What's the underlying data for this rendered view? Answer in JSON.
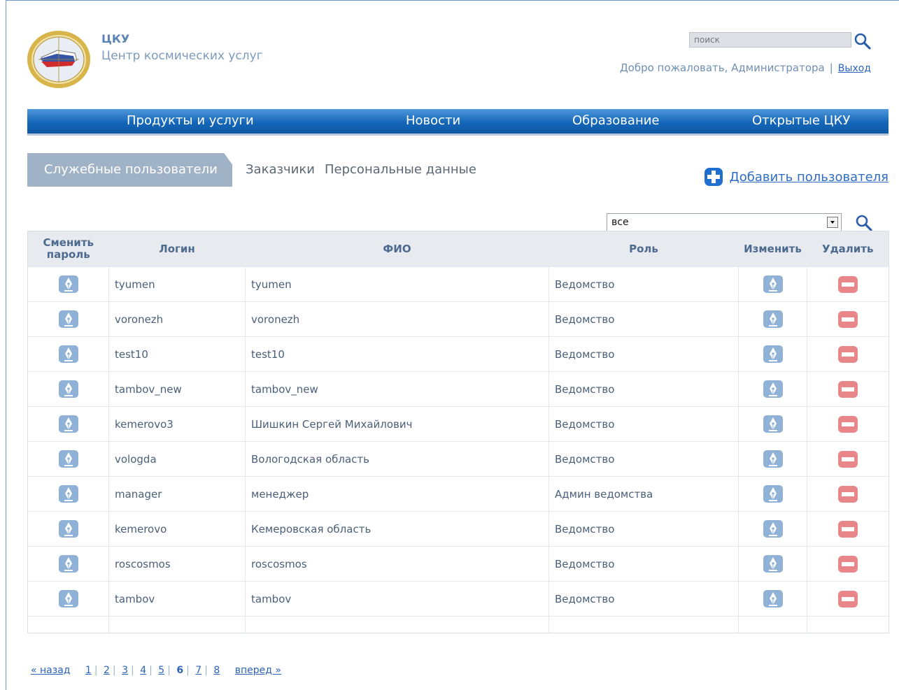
{
  "header": {
    "brand_short": "ЦКУ",
    "brand_full": "Центр космических услуг",
    "search_placeholder": "поиск",
    "welcome_text": "Добро пожаловать, Администратора",
    "separator": "|",
    "logout_label": "Выход"
  },
  "nav": {
    "items": [
      {
        "label": "Продукты и услуги"
      },
      {
        "label": "Новости"
      },
      {
        "label": "Образование"
      },
      {
        "label": "Открытые ЦКУ"
      }
    ]
  },
  "tabs": {
    "active_label": "Служебные пользователи",
    "items": [
      {
        "label": "Заказчики"
      },
      {
        "label": "Персональные данные"
      }
    ]
  },
  "add_user_label": "Добавить пользователя",
  "filter": {
    "selected": "все"
  },
  "table": {
    "headers": {
      "change_password": "Сменить пароль",
      "login": "Логин",
      "fio": "ФИО",
      "role": "Роль",
      "edit": "Изменить",
      "delete": "Удалить"
    },
    "rows": [
      {
        "login": "tyumen",
        "fio": "tyumen",
        "role": "Ведомство"
      },
      {
        "login": "voronezh",
        "fio": "voronezh",
        "role": "Ведомство"
      },
      {
        "login": "test10",
        "fio": "test10",
        "role": "Ведомство"
      },
      {
        "login": "tambov_new",
        "fio": "tambov_new",
        "role": "Ведомство"
      },
      {
        "login": "kemerovo3",
        "fio": "Шишкин Сергей Михайлович",
        "role": "Ведомство"
      },
      {
        "login": "vologda",
        "fio": "Вологодская область",
        "role": "Ведомство"
      },
      {
        "login": "manager",
        "fio": "менеджер",
        "role": "Админ ведомства"
      },
      {
        "login": "kemerovo",
        "fio": "Кемеровская область",
        "role": "Ведомство"
      },
      {
        "login": "roscosmos",
        "fio": "roscosmos",
        "role": "Ведомство"
      },
      {
        "login": "tambov",
        "fio": "tambov",
        "role": "Ведомство"
      }
    ]
  },
  "pagination": {
    "prev": "« назад",
    "next": "вперед »",
    "pages": [
      "1",
      "2",
      "3",
      "4",
      "5",
      "6",
      "7",
      "8"
    ],
    "current": "6"
  },
  "colors": {
    "nav_bar": "#1466b8",
    "active_tab": "#a0b2c6",
    "link": "#2f6dc3",
    "delete_icon": "#e8868a",
    "edit_icon": "#8fb2d6"
  },
  "icons": {
    "logo": "emblem-logo",
    "search": "magnifier-icon",
    "add": "plus-icon",
    "change_password": "pen-icon",
    "edit": "pen-icon",
    "delete": "minus-icon"
  }
}
